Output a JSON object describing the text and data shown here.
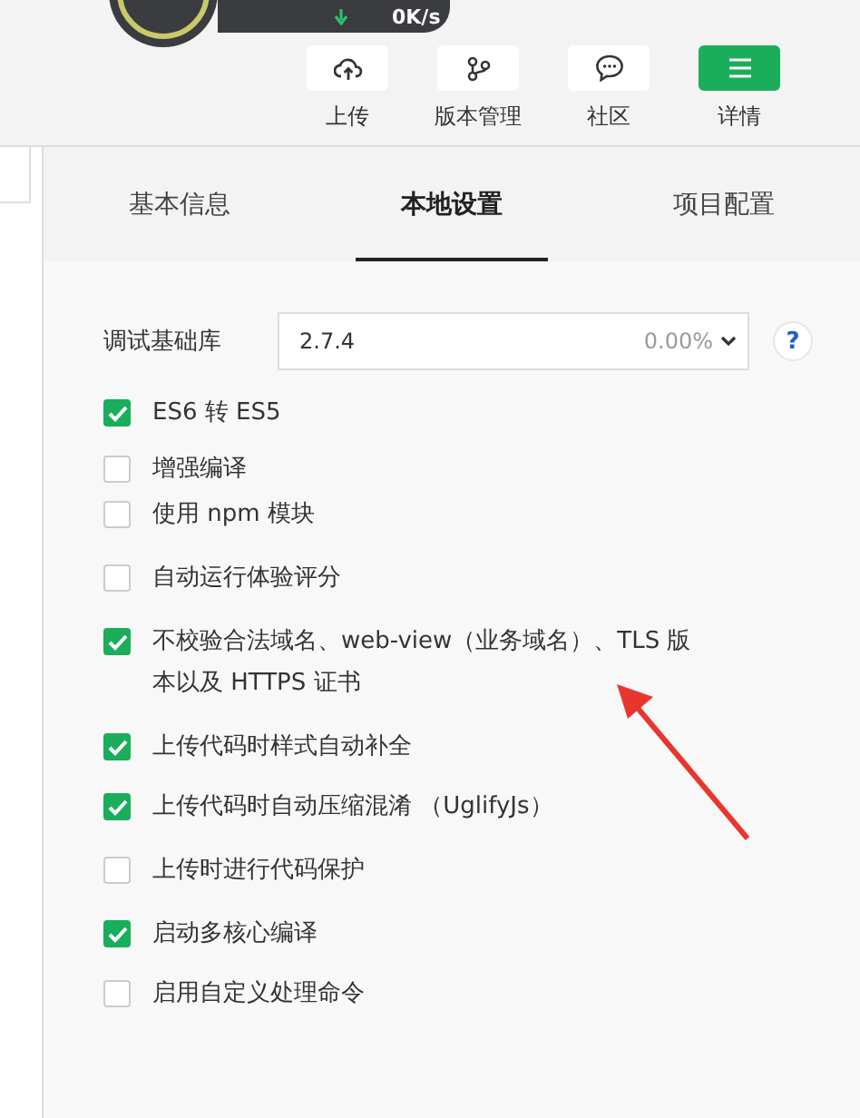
{
  "status": {
    "speed": "0K/s"
  },
  "toolbar": [
    {
      "label": "上传",
      "kind": "upload",
      "selected": false
    },
    {
      "label": "版本管理",
      "kind": "branch",
      "selected": false
    },
    {
      "label": "社区",
      "kind": "chat",
      "selected": false
    },
    {
      "label": "详情",
      "kind": "menu",
      "selected": true
    }
  ],
  "tabs": [
    {
      "label": "基本信息",
      "selected": false
    },
    {
      "label": "本地设置",
      "selected": true
    },
    {
      "label": "项目配置",
      "selected": false
    }
  ],
  "library": {
    "label": "调试基础库",
    "value": "2.7.4",
    "share": "0.00%",
    "help": "?"
  },
  "options": [
    {
      "label": "ES6 转 ES5",
      "checked": true
    },
    {
      "label": "增强编译",
      "checked": false
    },
    {
      "label": "使用 npm 模块",
      "checked": false
    },
    {
      "label": "自动运行体验评分",
      "checked": false
    },
    {
      "label": "不校验合法域名、web-view（业务域名）、TLS 版本以及 HTTPS 证书",
      "checked": true
    },
    {
      "label": "上传代码时样式自动补全",
      "checked": true
    },
    {
      "label": "上传代码时自动压缩混淆 （UglifyJs）",
      "checked": true
    },
    {
      "label": "上传时进行代码保护",
      "checked": false
    },
    {
      "label": "启动多核心编译",
      "checked": true
    },
    {
      "label": "启用自定义处理命令",
      "checked": false
    }
  ]
}
